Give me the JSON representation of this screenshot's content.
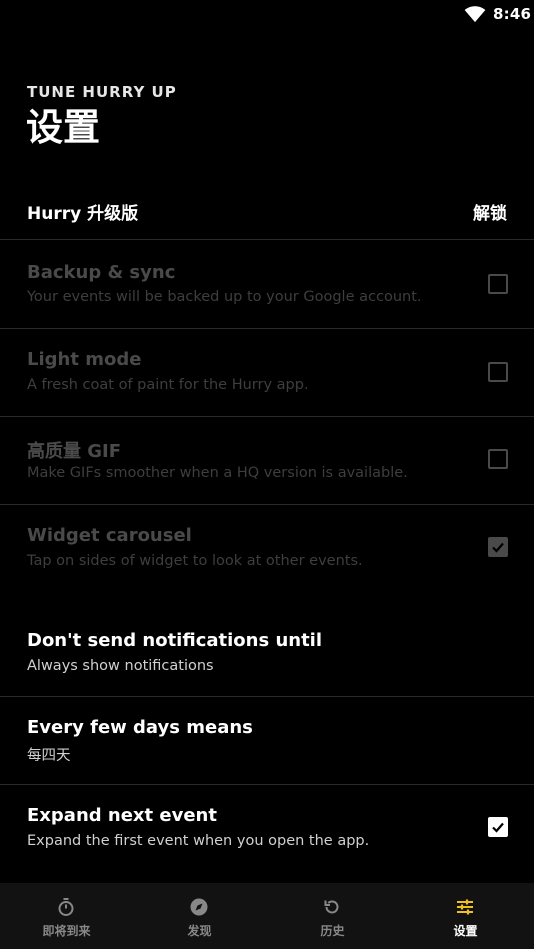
{
  "status": {
    "time": "8:46"
  },
  "header": {
    "subtitle": "TUNE HURRY UP",
    "title": "设置"
  },
  "upgrade": {
    "label": "Hurry 升级版",
    "action": "解锁"
  },
  "settings": [
    {
      "title": "Backup & sync",
      "desc": "Your events will be backed up to your Google account.",
      "checked": false,
      "enabled": false
    },
    {
      "title": "Light mode",
      "desc": "A fresh coat of paint for the Hurry app.",
      "checked": false,
      "enabled": false
    },
    {
      "title": "高质量 GIF",
      "desc": "Make GIFs smoother when a HQ version is available.",
      "checked": false,
      "enabled": false
    },
    {
      "title": "Widget carousel",
      "desc": "Tap on sides of widget to look at other events.",
      "checked": true,
      "enabled": false
    },
    {
      "title": "Don't send notifications until",
      "desc": "Always show notifications"
    },
    {
      "title": "Every few days means",
      "desc": "每四天"
    },
    {
      "title": "Expand next event",
      "desc": "Expand the first event when you open the app.",
      "checked": true,
      "enabled": true
    }
  ],
  "nav": [
    {
      "label": "即将到来",
      "icon": "stopwatch-icon"
    },
    {
      "label": "发现",
      "icon": "compass-icon"
    },
    {
      "label": "历史",
      "icon": "history-icon"
    },
    {
      "label": "设置",
      "icon": "sliders-icon",
      "active": true
    }
  ]
}
